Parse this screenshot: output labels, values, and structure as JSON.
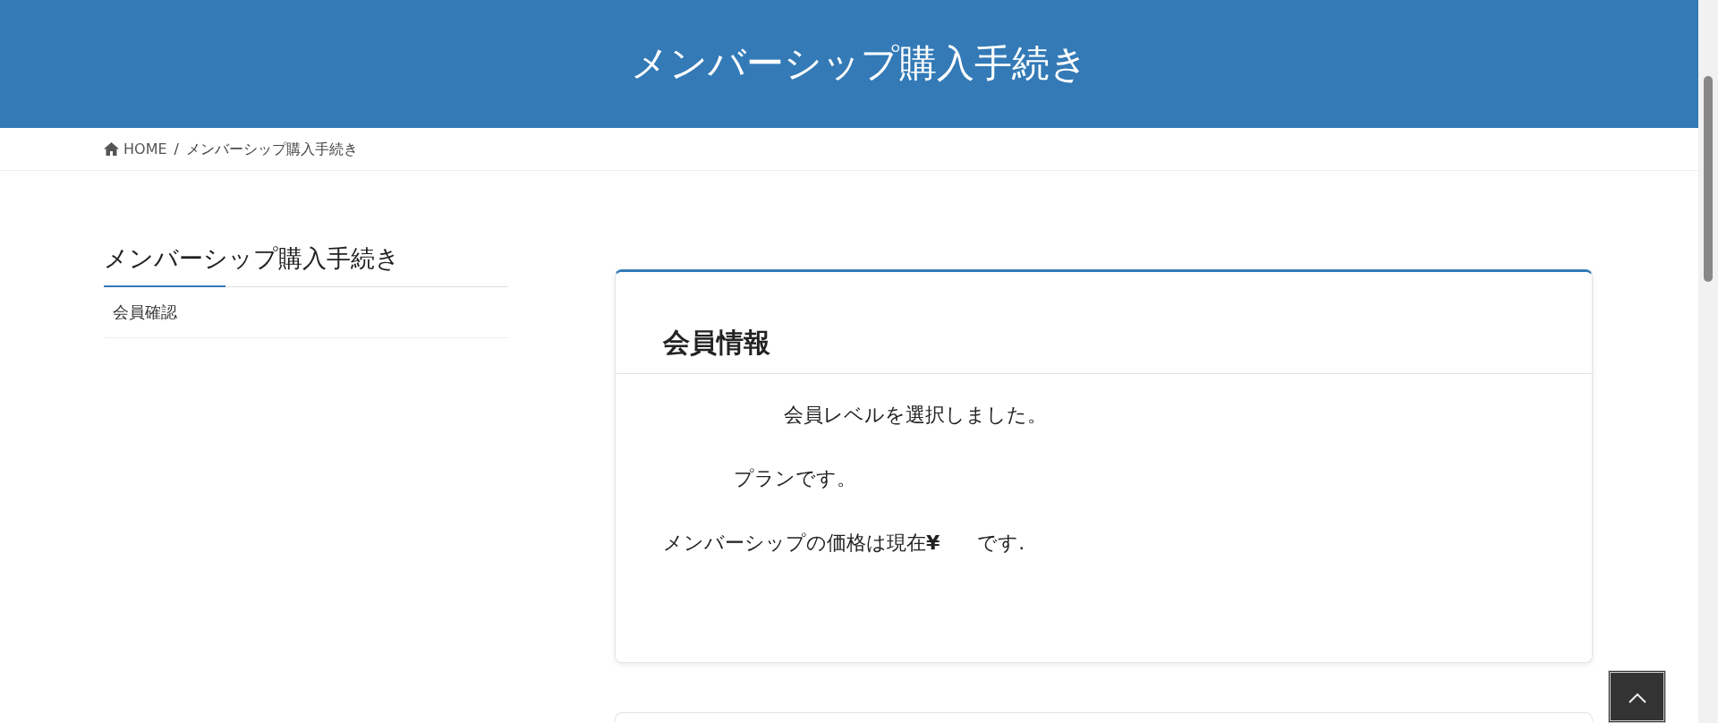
{
  "page_header": {
    "title": "メンバーシップ購入手続き"
  },
  "breadcrumb": [
    {
      "label": "HOME",
      "kind": "home"
    },
    {
      "label": "/",
      "kind": "separator"
    },
    {
      "label": "メンバーシップ購入手続き",
      "kind": "current"
    }
  ],
  "sidebar": {
    "title": "メンバーシップ購入手続き",
    "items": [
      {
        "label": "会員確認"
      }
    ]
  },
  "member_card": {
    "title": "会員情報",
    "lines": [
      {
        "text": "会員レベルを選択しました。",
        "kind": "masked"
      },
      {
        "text": "プランです。",
        "kind": "masked"
      },
      {
        "text": "メンバーシップの価格は現在**¥**",
        "suffix": "です.",
        "kind": "plain"
      }
    ]
  }
}
